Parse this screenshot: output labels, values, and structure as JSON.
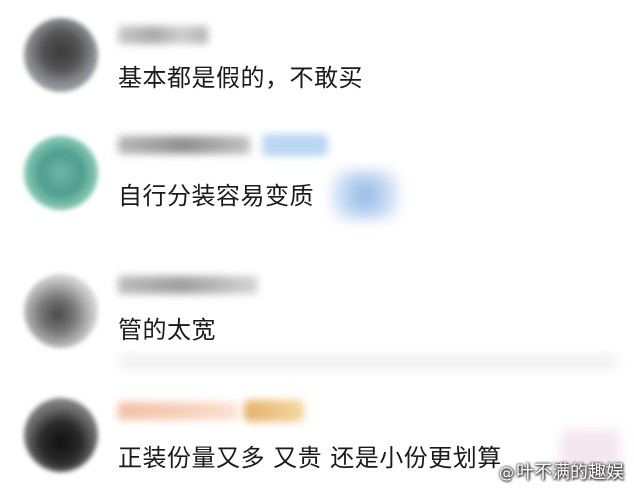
{
  "comments": [
    {
      "text": "基本都是假的，不敢买"
    },
    {
      "text": "自行分装容易变质"
    },
    {
      "text": "管的太宽"
    },
    {
      "text": "正装份量又多  又贵  还是小份更划算"
    }
  ],
  "watermark": {
    "icon": "at-icon",
    "text": "叶不满的趣娱"
  }
}
